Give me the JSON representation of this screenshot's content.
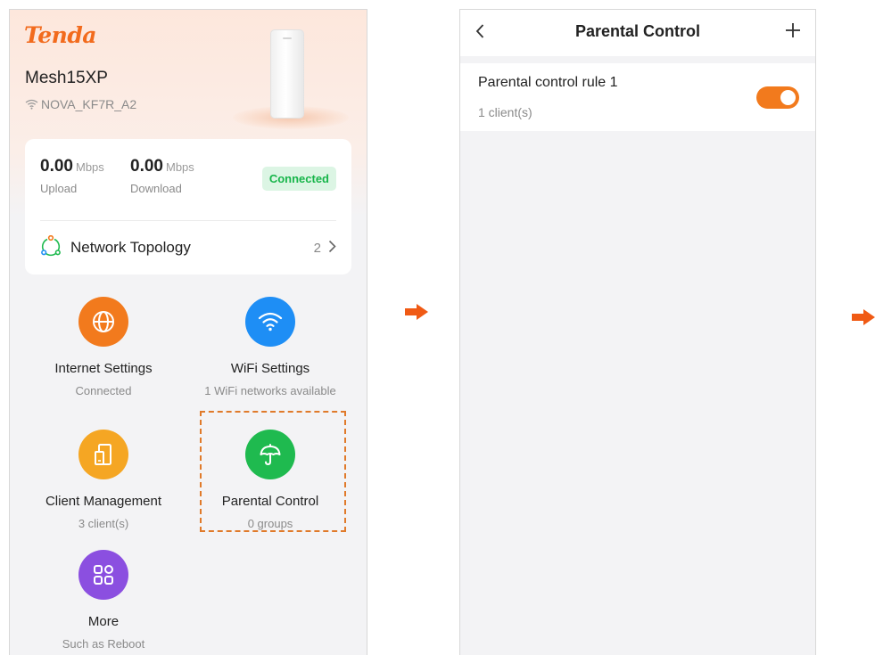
{
  "home": {
    "brand": "Tenda",
    "device_name": "Mesh15XP",
    "ssid": "NOVA_KF7R_A2",
    "upload_value": "0.00",
    "upload_unit": "Mbps",
    "upload_label": "Upload",
    "download_value": "0.00",
    "download_unit": "Mbps",
    "download_label": "Download",
    "status": "Connected",
    "topology_label": "Network Topology",
    "topology_count": "2",
    "tiles": [
      {
        "title": "Internet Settings",
        "subtitle": "Connected",
        "color": "#f27a1d",
        "icon": "globe-icon"
      },
      {
        "title": "WiFi Settings",
        "subtitle": "1 WiFi networks available",
        "color": "#1e8ef5",
        "icon": "wifi-icon"
      },
      {
        "title": "Client Management",
        "subtitle": "3 client(s)",
        "color": "#f5a623",
        "icon": "devices-icon"
      },
      {
        "title": "Parental Control",
        "subtitle": "0 groups",
        "color": "#1fba4f",
        "icon": "umbrella-icon"
      },
      {
        "title": "More",
        "subtitle": "Such as Reboot",
        "color": "#8b4fe0",
        "icon": "apps-grid-icon"
      }
    ]
  },
  "parental": {
    "title": "Parental Control",
    "rule_name": "Parental control rule 1",
    "rule_clients": "1 client(s)",
    "rule_enabled": true
  },
  "colors": {
    "accent": "#f26b1d",
    "connected_green": "#17b54a",
    "arrow": "#f05a14"
  }
}
